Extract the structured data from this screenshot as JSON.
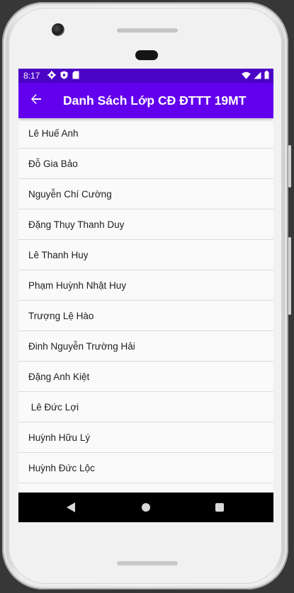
{
  "status_bar": {
    "time": "8:17",
    "left_icons": [
      "gear-icon",
      "shield-icon",
      "sd-card-icon"
    ],
    "right_icons": [
      "wifi-icon",
      "signal-icon",
      "battery-icon"
    ]
  },
  "app_bar": {
    "back_icon": "arrow-left-icon",
    "title": "Danh Sách Lớp CĐ ĐTTT 19MT"
  },
  "students": [
    "Lê Huế Anh",
    "Đỗ Gia Bảo",
    "Nguyễn Chí Cường",
    "Đặng Thụy Thanh Duy",
    "Lê Thanh Huy",
    "Phạm Huỳnh Nhật Huy",
    "Trượng Lệ Hào",
    "Đinh Nguyễn Trường Hải",
    "Đặng Anh Kiệt",
    " Lê Đức Lợi",
    "Huỳnh Hữu Lý",
    "Huỳnh Đức Lộc"
  ],
  "nav_bar": {
    "icons": [
      "back-triangle-icon",
      "home-circle-icon",
      "recents-square-icon"
    ]
  },
  "colors": {
    "status_bar": "#4b03c6",
    "app_bar": "#6200ee",
    "list_background": "#fafafa",
    "divider": "#dcdcdc",
    "nav_bar": "#000000"
  }
}
